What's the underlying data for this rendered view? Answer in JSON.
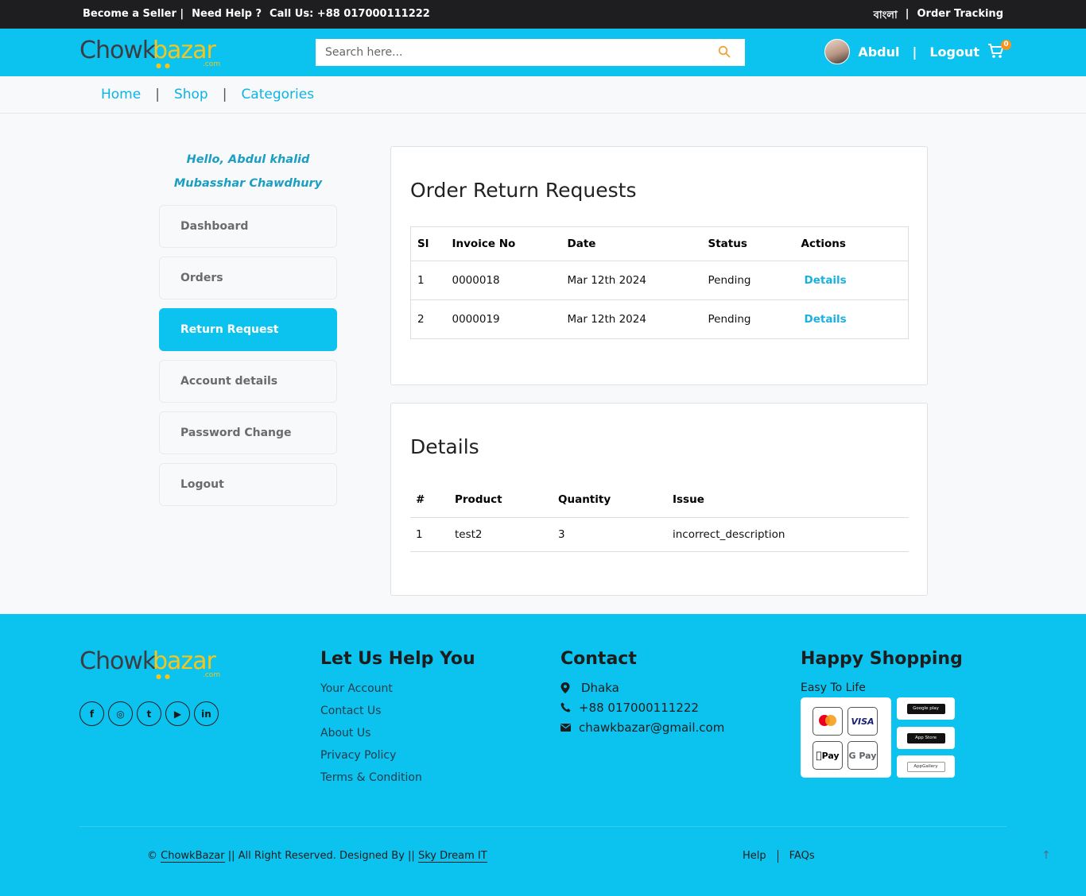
{
  "topbar": {
    "seller": "Become a Seller |",
    "help": "Need Help ?",
    "call": "Call Us: +88 017000111222",
    "lang": "বাংলা",
    "sep": "|",
    "tracking": "Order Tracking"
  },
  "header": {
    "logo_main": "Chowk",
    "logo_accent": "bazar",
    "logo_suffix": ".com",
    "search_placeholder": "Search here...",
    "user_name": "Abdul",
    "user_sep": "|",
    "logout": "Logout",
    "cart_count": "0"
  },
  "nav": {
    "items": [
      "Home",
      "Shop",
      "Categories"
    ],
    "sep": "|"
  },
  "sidebar": {
    "greeting_line1": "Hello, Abdul khalid",
    "greeting_line2": "Mubasshar Chawdhury",
    "items": [
      "Dashboard",
      "Orders",
      "Return Request",
      "Account details",
      "Password Change",
      "Logout"
    ],
    "active": "Return Request"
  },
  "returns": {
    "title": "Order Return Requests",
    "headers": [
      "Sl",
      "Invoice No",
      "Date",
      "Status",
      "Actions"
    ],
    "rows": [
      {
        "sl": "1",
        "invoice": "0000018",
        "date": "Mar 12th 2024",
        "status": "Pending",
        "action": "Details"
      },
      {
        "sl": "2",
        "invoice": "0000019",
        "date": "Mar 12th 2024",
        "status": "Pending",
        "action": "Details"
      }
    ]
  },
  "details": {
    "title": "Details",
    "headers": [
      "#",
      "Product",
      "Quantity",
      "Issue"
    ],
    "rows": [
      {
        "num": "1",
        "product": "test2",
        "qty": "3",
        "issue": "incorrect_description"
      }
    ]
  },
  "footer": {
    "help_title": "Let Us Help You",
    "help_links": [
      "Your Account",
      "Contact Us",
      "About Us",
      "Privacy Policy",
      "Terms & Condition"
    ],
    "contact_title": "Contact",
    "city": "Dhaka",
    "phone": "+88 017000111222",
    "email": "chawkbazar@gmail.com",
    "shopping_title": "Happy Shopping",
    "tagline": "Easy To Life",
    "socials": [
      "facebook",
      "instagram",
      "twitter",
      "youtube",
      "linkedin"
    ],
    "copyright_pre": "©",
    "brand_link": "ChowkBazar",
    "copyright_mid": "|| All Right Reserved. Designed By ||",
    "designer_link": "Sky Dream IT",
    "bottom_links": [
      "Help",
      "FAQs"
    ],
    "stores": [
      "Google play",
      "App Store",
      "AppGallery"
    ],
    "pay_methods": [
      "mastercard",
      "VISA",
      "Pay",
      "G Pay"
    ]
  },
  "colors": {
    "primary": "#0cc3f0",
    "topbar": "#1e1d1f",
    "logo_accent": "#f5c51b"
  }
}
